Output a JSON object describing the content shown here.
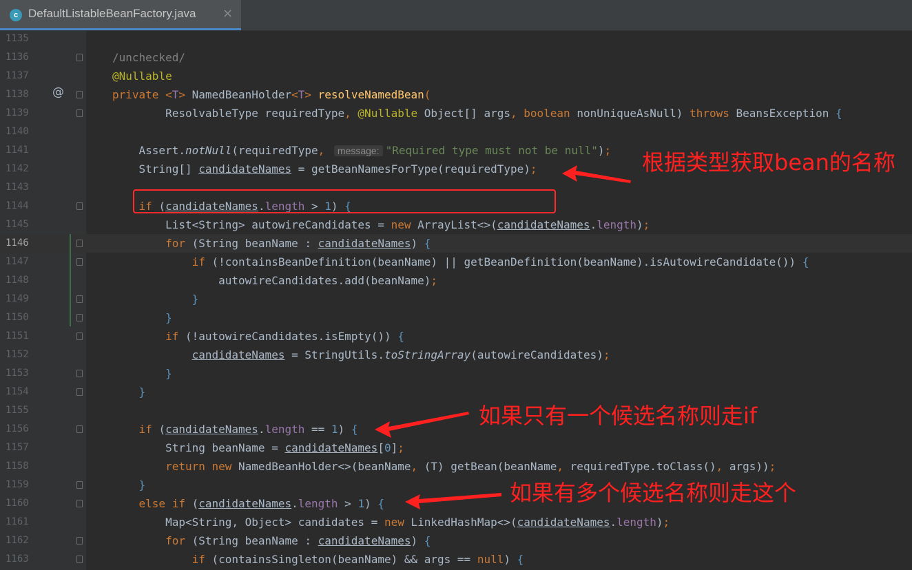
{
  "tab": {
    "icon_letter": "c",
    "title": "DefaultListableBeanFactory.java",
    "close_glyph": "×"
  },
  "callouts": {
    "c1": "根据类型获取bean的名称",
    "c2": "如果只有一个候选名称则走if",
    "c3": "如果有多个候选名称则走这个"
  },
  "lines": [
    {
      "n": "1135",
      "fold": false,
      "tokens": []
    },
    {
      "n": "1136",
      "fold": true,
      "tokens": [
        {
          "t": "/unchecked/",
          "c": "cmt"
        }
      ]
    },
    {
      "n": "1137",
      "fold": false,
      "tokens": [
        {
          "t": "@Nullable",
          "c": "ann"
        }
      ]
    },
    {
      "n": "1138",
      "fold": true,
      "mark": "@",
      "tokens": [
        {
          "t": "private ",
          "c": "kw"
        },
        {
          "t": "<",
          "c": "kw"
        },
        {
          "t": "T",
          "c": "ty"
        },
        {
          "t": "> ",
          "c": "kw"
        },
        {
          "t": "NamedBeanHolder"
        },
        {
          "t": "<",
          "c": "kw"
        },
        {
          "t": "T",
          "c": "ty"
        },
        {
          "t": "> ",
          "c": "kw"
        },
        {
          "t": "resolveNamedBean",
          "c": "fn"
        },
        {
          "t": "(",
          "c": "kw"
        }
      ]
    },
    {
      "n": "1139",
      "fold": true,
      "tokens": [
        {
          "t": "        ResolvableType requiredType"
        },
        {
          "t": ", ",
          "c": "kw"
        },
        {
          "t": "@Nullable ",
          "c": "ann"
        },
        {
          "t": "Object[] args"
        },
        {
          "t": ", ",
          "c": "kw"
        },
        {
          "t": "boolean ",
          "c": "kw"
        },
        {
          "t": "nonUniqueAsNull) "
        },
        {
          "t": "throws ",
          "c": "kw"
        },
        {
          "t": "BeansException "
        },
        {
          "t": "{",
          "c": "br"
        }
      ]
    },
    {
      "n": "1140",
      "fold": false,
      "tokens": []
    },
    {
      "n": "1141",
      "fold": false,
      "tokens": [
        {
          "t": "    Assert."
        },
        {
          "t": "notNull",
          "c": "it"
        },
        {
          "t": "(requiredType"
        },
        {
          "t": ", ",
          "c": "kw"
        },
        {
          "t": "message:",
          "c": "hint"
        },
        {
          "t": "\"Required type must not be null\"",
          "c": "str"
        },
        {
          "t": ")"
        },
        {
          "t": ";",
          "c": "kw"
        }
      ]
    },
    {
      "n": "1142",
      "fold": false,
      "tokens": [
        {
          "t": "    String[] "
        },
        {
          "t": "candidateNames",
          "c": "ul"
        },
        {
          "t": " = getBeanNamesForType(requiredType)"
        },
        {
          "t": ";",
          "c": "kw"
        }
      ]
    },
    {
      "n": "1143",
      "fold": false,
      "tokens": []
    },
    {
      "n": "1144",
      "fold": true,
      "tokens": [
        {
          "t": "    "
        },
        {
          "t": "if ",
          "c": "kw"
        },
        {
          "t": "("
        },
        {
          "t": "candidateNames",
          "c": "ul"
        },
        {
          "t": "."
        },
        {
          "t": "length",
          "c": "fld"
        },
        {
          "t": " > "
        },
        {
          "t": "1",
          "c": "num"
        },
        {
          "t": ") "
        },
        {
          "t": "{",
          "c": "br"
        }
      ]
    },
    {
      "n": "1145",
      "fold": false,
      "tokens": [
        {
          "t": "        List<String> autowireCandidates = "
        },
        {
          "t": "new ",
          "c": "kw"
        },
        {
          "t": "ArrayList<>("
        },
        {
          "t": "candidateNames",
          "c": "ul"
        },
        {
          "t": "."
        },
        {
          "t": "length",
          "c": "fld"
        },
        {
          "t": ")"
        },
        {
          "t": ";",
          "c": "kw"
        }
      ]
    },
    {
      "n": "1146",
      "fold": true,
      "current": true,
      "tokens": [
        {
          "t": "        "
        },
        {
          "t": "for ",
          "c": "kw"
        },
        {
          "t": "(String beanName : "
        },
        {
          "t": "candidateNames",
          "c": "ul"
        },
        {
          "t": ") "
        },
        {
          "t": "{",
          "c": "br"
        }
      ]
    },
    {
      "n": "1147",
      "fold": true,
      "tokens": [
        {
          "t": "            "
        },
        {
          "t": "if ",
          "c": "kw"
        },
        {
          "t": "(!containsBeanDefinition(beanName) || getBeanDefinition(beanName).isAutowireCandidate()) "
        },
        {
          "t": "{",
          "c": "br"
        }
      ]
    },
    {
      "n": "1148",
      "fold": false,
      "tokens": [
        {
          "t": "                autowireCandidates.add(beanName)"
        },
        {
          "t": ";",
          "c": "kw"
        }
      ]
    },
    {
      "n": "1149",
      "fold": true,
      "tokens": [
        {
          "t": "            "
        },
        {
          "t": "}",
          "c": "br"
        }
      ]
    },
    {
      "n": "1150",
      "fold": true,
      "tokens": [
        {
          "t": "        "
        },
        {
          "t": "}",
          "c": "br"
        }
      ]
    },
    {
      "n": "1151",
      "fold": true,
      "tokens": [
        {
          "t": "        "
        },
        {
          "t": "if ",
          "c": "kw"
        },
        {
          "t": "(!autowireCandidates.isEmpty()) "
        },
        {
          "t": "{",
          "c": "br"
        }
      ]
    },
    {
      "n": "1152",
      "fold": false,
      "tokens": [
        {
          "t": "            "
        },
        {
          "t": "candidateNames",
          "c": "ul"
        },
        {
          "t": " = StringUtils."
        },
        {
          "t": "toStringArray",
          "c": "it"
        },
        {
          "t": "(autowireCandidates)"
        },
        {
          "t": ";",
          "c": "kw"
        }
      ]
    },
    {
      "n": "1153",
      "fold": true,
      "tokens": [
        {
          "t": "        "
        },
        {
          "t": "}",
          "c": "br"
        }
      ]
    },
    {
      "n": "1154",
      "fold": true,
      "tokens": [
        {
          "t": "    "
        },
        {
          "t": "}",
          "c": "br"
        }
      ]
    },
    {
      "n": "1155",
      "fold": false,
      "tokens": []
    },
    {
      "n": "1156",
      "fold": true,
      "tokens": [
        {
          "t": "    "
        },
        {
          "t": "if ",
          "c": "kw"
        },
        {
          "t": "("
        },
        {
          "t": "candidateNames",
          "c": "ul"
        },
        {
          "t": "."
        },
        {
          "t": "length",
          "c": "fld"
        },
        {
          "t": " == "
        },
        {
          "t": "1",
          "c": "num"
        },
        {
          "t": ") "
        },
        {
          "t": "{",
          "c": "br"
        }
      ]
    },
    {
      "n": "1157",
      "fold": false,
      "tokens": [
        {
          "t": "        String beanName = "
        },
        {
          "t": "candidateNames",
          "c": "ul"
        },
        {
          "t": "["
        },
        {
          "t": "0",
          "c": "num"
        },
        {
          "t": "]"
        },
        {
          "t": ";",
          "c": "kw"
        }
      ]
    },
    {
      "n": "1158",
      "fold": false,
      "tokens": [
        {
          "t": "        "
        },
        {
          "t": "return new ",
          "c": "kw"
        },
        {
          "t": "NamedBeanHolder<>(beanName"
        },
        {
          "t": ", ",
          "c": "kw"
        },
        {
          "t": "(T) getBean(beanName"
        },
        {
          "t": ", ",
          "c": "kw"
        },
        {
          "t": "requiredType.toClass()"
        },
        {
          "t": ", ",
          "c": "kw"
        },
        {
          "t": "args))"
        },
        {
          "t": ";",
          "c": "kw"
        }
      ]
    },
    {
      "n": "1159",
      "fold": true,
      "tokens": [
        {
          "t": "    "
        },
        {
          "t": "}",
          "c": "br"
        }
      ]
    },
    {
      "n": "1160",
      "fold": true,
      "tokens": [
        {
          "t": "    "
        },
        {
          "t": "else if ",
          "c": "kw"
        },
        {
          "t": "("
        },
        {
          "t": "candidateNames",
          "c": "ul"
        },
        {
          "t": "."
        },
        {
          "t": "length",
          "c": "fld"
        },
        {
          "t": " > "
        },
        {
          "t": "1",
          "c": "num"
        },
        {
          "t": ") "
        },
        {
          "t": "{",
          "c": "br"
        }
      ]
    },
    {
      "n": "1161",
      "fold": false,
      "tokens": [
        {
          "t": "        Map<String, Object> candidates = "
        },
        {
          "t": "new ",
          "c": "kw"
        },
        {
          "t": "LinkedHashMap<>("
        },
        {
          "t": "candidateNames",
          "c": "ul"
        },
        {
          "t": "."
        },
        {
          "t": "length",
          "c": "fld"
        },
        {
          "t": ")"
        },
        {
          "t": ";",
          "c": "kw"
        }
      ]
    },
    {
      "n": "1162",
      "fold": true,
      "tokens": [
        {
          "t": "        "
        },
        {
          "t": "for ",
          "c": "kw"
        },
        {
          "t": "(String beanName : "
        },
        {
          "t": "candidateNames",
          "c": "ul"
        },
        {
          "t": ") "
        },
        {
          "t": "{",
          "c": "br"
        }
      ]
    },
    {
      "n": "1163",
      "fold": true,
      "tokens": [
        {
          "t": "            "
        },
        {
          "t": "if ",
          "c": "kw"
        },
        {
          "t": "(containsSingleton(beanName) && args == "
        },
        {
          "t": "null",
          "c": "kw"
        },
        {
          "t": ") "
        },
        {
          "t": "{",
          "c": "br"
        }
      ]
    }
  ]
}
